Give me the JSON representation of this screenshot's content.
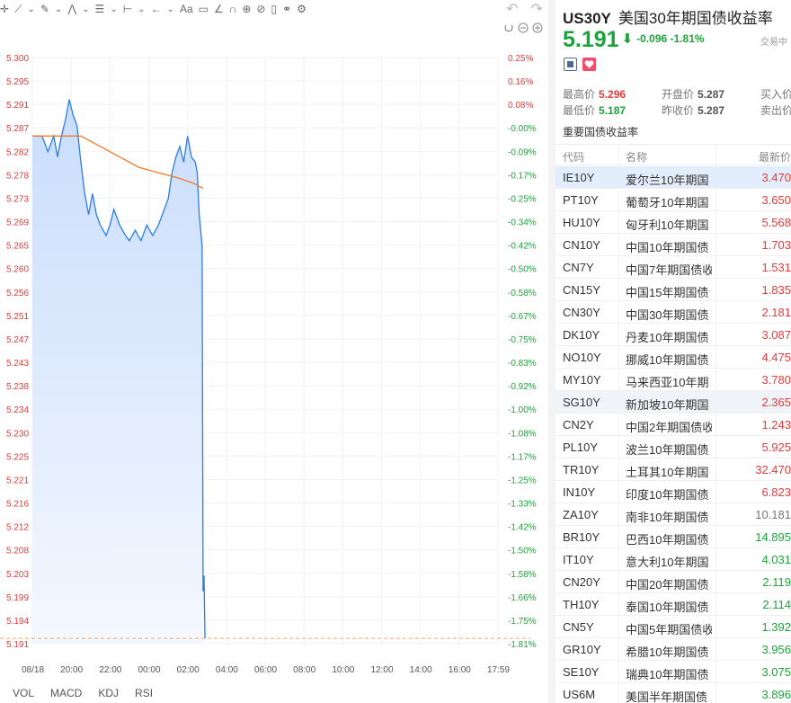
{
  "toolbar": {
    "icons": [
      "crosshair-icon",
      "trend-line-icon",
      "pen-icon",
      "zigzag-icon",
      "fib-icon",
      "range-icon",
      "arrow-icon",
      "text-icon",
      "comment-icon",
      "ruler-icon",
      "magnet-icon",
      "lock-icon",
      "eye-off-icon",
      "trash-icon",
      "compare-icon",
      "settings-icon",
      "undo-icon",
      "redo-icon"
    ],
    "text_tool": "Aa"
  },
  "chart_data": {
    "type": "line",
    "title": "",
    "x_ticks": [
      "08/18",
      "20:00",
      "22:00",
      "00:00",
      "02:00",
      "04:00",
      "06:00",
      "08:00",
      "10:00",
      "12:00",
      "14:00",
      "16:00",
      "17:59"
    ],
    "y_ticks_left": [
      "5.300",
      "5.295",
      "5.291",
      "5.287",
      "5.282",
      "5.278",
      "5.273",
      "5.269",
      "5.265",
      "5.260",
      "5.256",
      "5.251",
      "5.247",
      "5.243",
      "5.238",
      "5.234",
      "5.230",
      "5.225",
      "5.221",
      "5.216",
      "5.212",
      "5.208",
      "5.203",
      "5.199",
      "5.194",
      "5.191"
    ],
    "y_ticks_right": [
      "0.25%",
      "0.16%",
      "0.08%",
      "-0.00%",
      "-0.09%",
      "-0.17%",
      "-0.25%",
      "-0.34%",
      "-0.42%",
      "-0.50%",
      "-0.58%",
      "-0.67%",
      "-0.75%",
      "-0.83%",
      "-0.92%",
      "-1.00%",
      "-1.08%",
      "-1.17%",
      "-1.25%",
      "-1.33%",
      "-1.42%",
      "-1.50%",
      "-1.58%",
      "-1.66%",
      "-1.75%",
      "-1.81%"
    ],
    "ylim": [
      5.19,
      5.302
    ],
    "prev_close": 5.287,
    "last_value": 5.191,
    "x_hours": [
      -6,
      18
    ],
    "series": [
      {
        "values": [
          [
            -6.0,
            5.287
          ],
          [
            -5.5,
            5.287
          ],
          [
            -5.2,
            5.284
          ],
          [
            -4.9,
            5.287
          ],
          [
            -4.7,
            5.283
          ],
          [
            -4.5,
            5.287
          ],
          [
            -4.3,
            5.29
          ],
          [
            -4.1,
            5.294
          ],
          [
            -3.9,
            5.291
          ],
          [
            -3.7,
            5.289
          ],
          [
            -3.5,
            5.282
          ],
          [
            -3.3,
            5.276
          ],
          [
            -3.1,
            5.272
          ],
          [
            -2.9,
            5.276
          ],
          [
            -2.7,
            5.272
          ],
          [
            -2.5,
            5.27
          ],
          [
            -2.2,
            5.268
          ],
          [
            -2.0,
            5.27
          ],
          [
            -1.8,
            5.273
          ],
          [
            -1.5,
            5.27
          ],
          [
            -1.2,
            5.268
          ],
          [
            -1.0,
            5.267
          ],
          [
            -0.7,
            5.269
          ],
          [
            -0.4,
            5.267
          ],
          [
            -0.1,
            5.27
          ],
          [
            0.2,
            5.268
          ],
          [
            0.5,
            5.27
          ],
          [
            0.7,
            5.272
          ],
          [
            1.0,
            5.275
          ],
          [
            1.2,
            5.28
          ],
          [
            1.4,
            5.283
          ],
          [
            1.6,
            5.285
          ],
          [
            1.8,
            5.282
          ],
          [
            2.0,
            5.287
          ],
          [
            2.2,
            5.283
          ],
          [
            2.4,
            5.282
          ],
          [
            2.5,
            5.28
          ],
          [
            2.6,
            5.272
          ],
          [
            2.7,
            5.268
          ],
          [
            2.75,
            5.266
          ],
          [
            2.8,
            5.2
          ],
          [
            2.85,
            5.203
          ],
          [
            2.9,
            5.191
          ]
        ]
      },
      {
        "values": [
          [
            -6.0,
            5.287
          ],
          [
            -4.5,
            5.287
          ],
          [
            -3.5,
            5.287
          ],
          [
            -2.5,
            5.285
          ],
          [
            -1.5,
            5.283
          ],
          [
            -0.5,
            5.281
          ],
          [
            0.5,
            5.28
          ],
          [
            1.5,
            5.279
          ],
          [
            2.3,
            5.278
          ],
          [
            2.8,
            5.277
          ]
        ]
      }
    ]
  },
  "indicators": [
    "VOL",
    "MACD",
    "KDJ",
    "RSI"
  ],
  "quote": {
    "symbol": "US30Y",
    "name": "美国30年期国债收益率",
    "price": "5.191",
    "change": "-0.096",
    "change_pct": "-1.81%",
    "status": "交易中",
    "arrow": "⬇",
    "high_label": "最高价",
    "high": "5.296",
    "open_label": "开盘价",
    "open": "5.287",
    "buy_label": "买入价",
    "low_label": "最低价",
    "low": "5.187",
    "prevclose_label": "昨收价",
    "prevclose": "5.287",
    "sell_label": "卖出价"
  },
  "table": {
    "title": "重要国债收益率",
    "headers": [
      "代码",
      "名称",
      "最新价"
    ],
    "rows": [
      {
        "code": "IE10Y",
        "name": "爱尔兰10年期国",
        "price": "3.470",
        "dir": "up"
      },
      {
        "code": "PT10Y",
        "name": "葡萄牙10年期国",
        "price": "3.650",
        "dir": "up"
      },
      {
        "code": "HU10Y",
        "name": "匈牙利10年期国",
        "price": "5.568",
        "dir": "up"
      },
      {
        "code": "CN10Y",
        "name": "中国10年期国债",
        "price": "1.703",
        "dir": "up"
      },
      {
        "code": "CN7Y",
        "name": "中国7年期国债收",
        "price": "1.531",
        "dir": "up"
      },
      {
        "code": "CN15Y",
        "name": "中国15年期国债",
        "price": "1.835",
        "dir": "up"
      },
      {
        "code": "CN30Y",
        "name": "中国30年期国债",
        "price": "2.181",
        "dir": "up"
      },
      {
        "code": "DK10Y",
        "name": "丹麦10年期国债",
        "price": "3.087",
        "dir": "up"
      },
      {
        "code": "NO10Y",
        "name": "挪威10年期国债",
        "price": "4.475",
        "dir": "up"
      },
      {
        "code": "MY10Y",
        "name": "马来西亚10年期",
        "price": "3.780",
        "dir": "up"
      },
      {
        "code": "SG10Y",
        "name": "新加坡10年期国",
        "price": "2.365",
        "dir": "up"
      },
      {
        "code": "CN2Y",
        "name": "中国2年期国债收",
        "price": "1.243",
        "dir": "up"
      },
      {
        "code": "PL10Y",
        "name": "波兰10年期国债",
        "price": "5.925",
        "dir": "up"
      },
      {
        "code": "TR10Y",
        "name": "土耳其10年期国",
        "price": "32.470",
        "dir": "up"
      },
      {
        "code": "IN10Y",
        "name": "印度10年期国债",
        "price": "6.823",
        "dir": "up"
      },
      {
        "code": "ZA10Y",
        "name": "南非10年期国债",
        "price": "10.181",
        "dir": "flat"
      },
      {
        "code": "BR10Y",
        "name": "巴西10年期国债",
        "price": "14.895",
        "dir": "down"
      },
      {
        "code": "IT10Y",
        "name": "意大利10年期国",
        "price": "4.031",
        "dir": "down"
      },
      {
        "code": "CN20Y",
        "name": "中国20年期国债",
        "price": "2.119",
        "dir": "down"
      },
      {
        "code": "TH10Y",
        "name": "泰国10年期国债",
        "price": "2.114",
        "dir": "down"
      },
      {
        "code": "CN5Y",
        "name": "中国5年期国债收",
        "price": "1.392",
        "dir": "down"
      },
      {
        "code": "GR10Y",
        "name": "希腊10年期国债",
        "price": "3.956",
        "dir": "down"
      },
      {
        "code": "SE10Y",
        "name": "瑞典10年期国债",
        "price": "3.075",
        "dir": "down"
      },
      {
        "code": "US6M",
        "name": "美国半年期国债",
        "price": "3.896",
        "dir": "down"
      }
    ]
  },
  "colors": {
    "up": "#e03b3b",
    "down": "#1ea33c",
    "flat": "#777777",
    "line": "#2b7de9",
    "ma": "#f07b2a",
    "highlight": "#e3eefc"
  }
}
